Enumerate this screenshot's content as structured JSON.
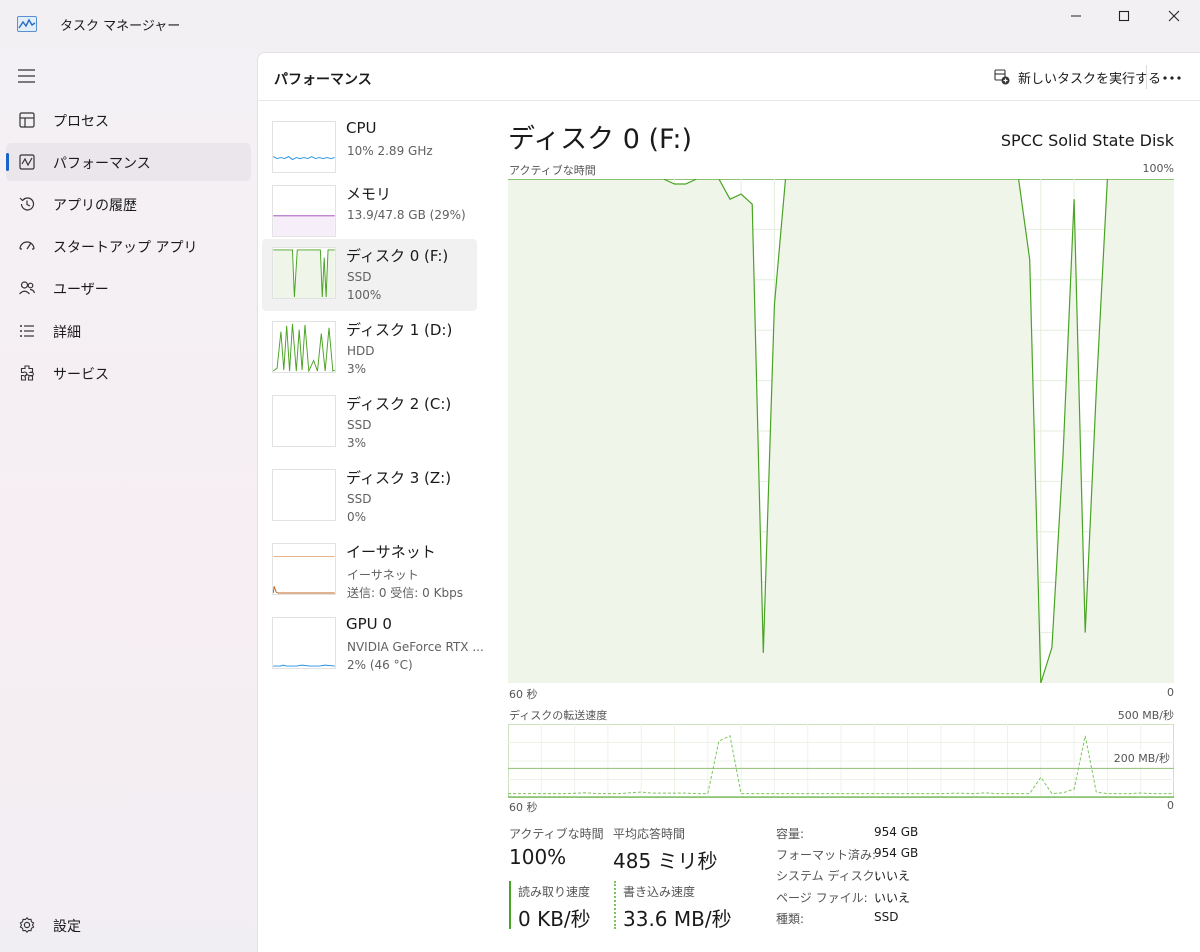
{
  "window": {
    "title": "タスク マネージャー"
  },
  "sidebar": {
    "items": [
      {
        "label": "プロセス",
        "icon": "process-icon"
      },
      {
        "label": "パフォーマンス",
        "icon": "performance-icon",
        "selected": true
      },
      {
        "label": "アプリの履歴",
        "icon": "history-icon"
      },
      {
        "label": "スタートアップ アプリ",
        "icon": "startup-icon"
      },
      {
        "label": "ユーザー",
        "icon": "users-icon"
      },
      {
        "label": "詳細",
        "icon": "details-icon"
      },
      {
        "label": "サービス",
        "icon": "services-icon"
      }
    ],
    "settings_label": "設定"
  },
  "header": {
    "title": "パフォーマンス",
    "run_task_label": "新しいタスクを実行する"
  },
  "devices": [
    {
      "name": "CPU",
      "sub1": "10%  2.89 GHz",
      "sub2": "",
      "color": "#1d8fe0"
    },
    {
      "name": "メモリ",
      "sub1": "13.9/47.8 GB (29%)",
      "sub2": "",
      "color": "#9b3db2"
    },
    {
      "name": "ディスク 0 (F:)",
      "sub1": "SSD",
      "sub2": "100%",
      "color": "#4aa324",
      "selected": true
    },
    {
      "name": "ディスク 1 (D:)",
      "sub1": "HDD",
      "sub2": "3%",
      "color": "#4aa324"
    },
    {
      "name": "ディスク 2 (C:)",
      "sub1": "SSD",
      "sub2": "3%",
      "color": "#4aa324"
    },
    {
      "name": "ディスク 3 (Z:)",
      "sub1": "SSD",
      "sub2": "0%",
      "color": "#4aa324"
    },
    {
      "name": "イーサネット",
      "sub1": "イーサネット",
      "sub2": "送信: 0  受信: 0 Kbps",
      "color": "#c0631d"
    },
    {
      "name": "GPU 0",
      "sub1": "NVIDIA GeForce RTX ...",
      "sub2": "2%  (46 °C)",
      "color": "#1d8fe0"
    }
  ],
  "detail": {
    "title": "ディスク 0 (F:)",
    "model": "SPCC Solid State Disk",
    "active_time_chart": {
      "label": "アクティブな時間",
      "max_label": "100%",
      "x_left_label": "60 秒",
      "x_right_label": "0"
    },
    "transfer_chart": {
      "label": "ディスクの転送速度",
      "max_label": "500 MB/秒",
      "mid_label": "200 MB/秒",
      "x_left_label": "60 秒",
      "x_right_label": "0"
    },
    "stats": {
      "active_time_label": "アクティブな時間",
      "active_time_value": "100%",
      "avg_response_label": "平均応答時間",
      "avg_response_value": "485 ミリ秒",
      "read_label": "読み取り速度",
      "read_value": "0 KB/秒",
      "write_label": "書き込み速度",
      "write_value": "33.6 MB/秒"
    },
    "info": [
      {
        "key": "容量:",
        "value": "954 GB"
      },
      {
        "key": "フォーマット済み:",
        "value": "954 GB"
      },
      {
        "key": "システム ディスク:",
        "value": "いいえ"
      },
      {
        "key": "ページ ファイル:",
        "value": "いいえ"
      },
      {
        "key": "種類:",
        "value": "SSD"
      }
    ]
  },
  "colors": {
    "disk_line": "#4aa324",
    "disk_fill": "#eff6e9",
    "grid": "#e4eedd",
    "accent": "#1a63c8"
  },
  "chart_data": [
    {
      "type": "area",
      "title": "アクティブな時間",
      "xlabel": "",
      "ylabel": "",
      "x_range": [
        60,
        0
      ],
      "ylim": [
        0,
        100
      ],
      "x": [
        60,
        59,
        58,
        57,
        56,
        55,
        54,
        53,
        52,
        51,
        50,
        49,
        48,
        47,
        46,
        45,
        44,
        43,
        42,
        41,
        40,
        39,
        38,
        37,
        36,
        35,
        34,
        33,
        32,
        31,
        30,
        29,
        28,
        27,
        26,
        25,
        24,
        23,
        22,
        21,
        20,
        19,
        18,
        17,
        16,
        15,
        14,
        13,
        12,
        11,
        10,
        9,
        8,
        7,
        6,
        5,
        4,
        3,
        2,
        1,
        0
      ],
      "series": [
        {
          "values": [
            100,
            100,
            100,
            100,
            100,
            100,
            100,
            100,
            100,
            100,
            100,
            100,
            100,
            100,
            100,
            99,
            99,
            100,
            100,
            100,
            96,
            97,
            95,
            6,
            75,
            100,
            100,
            100,
            100,
            100,
            100,
            100,
            100,
            100,
            100,
            100,
            100,
            100,
            100,
            100,
            100,
            100,
            100,
            100,
            100,
            100,
            100,
            84,
            0,
            7,
            45,
            96,
            10,
            58,
            100,
            100,
            100,
            100,
            100,
            100,
            100
          ]
        }
      ]
    },
    {
      "type": "line",
      "title": "ディスクの転送速度",
      "xlabel": "",
      "ylabel": "",
      "x_range": [
        60,
        0
      ],
      "ylim": [
        0,
        500
      ],
      "x": [
        60,
        59,
        58,
        57,
        56,
        55,
        54,
        53,
        52,
        51,
        50,
        49,
        48,
        47,
        46,
        45,
        44,
        43,
        42,
        41,
        40,
        39,
        38,
        37,
        36,
        35,
        34,
        33,
        32,
        31,
        30,
        29,
        28,
        27,
        26,
        25,
        24,
        23,
        22,
        21,
        20,
        19,
        18,
        17,
        16,
        15,
        14,
        13,
        12,
        11,
        10,
        9,
        8,
        7,
        6,
        5,
        4,
        3,
        2,
        1,
        0
      ],
      "series": [
        {
          "name": "読み取り速度",
          "values": [
            0,
            0,
            0,
            0,
            0,
            0,
            0,
            0,
            0,
            0,
            0,
            0,
            0,
            0,
            0,
            0,
            0,
            0,
            0,
            0,
            0,
            0,
            0,
            0,
            0,
            0,
            0,
            0,
            0,
            0,
            0,
            0,
            0,
            0,
            0,
            0,
            0,
            0,
            0,
            0,
            0,
            0,
            0,
            0,
            0,
            0,
            0,
            0,
            0,
            0,
            0,
            0,
            0,
            0,
            0,
            0,
            0,
            0,
            0,
            0,
            0
          ]
        },
        {
          "name": "書き込み速度",
          "values": [
            30,
            30,
            30,
            30,
            30,
            30,
            32,
            35,
            30,
            30,
            30,
            35,
            40,
            33,
            33,
            33,
            33,
            30,
            30,
            385,
            420,
            30,
            30,
            30,
            30,
            30,
            30,
            30,
            30,
            30,
            30,
            30,
            30,
            30,
            30,
            30,
            30,
            30,
            30,
            30,
            32,
            32,
            30,
            35,
            30,
            30,
            30,
            30,
            140,
            30,
            35,
            60,
            420,
            40,
            30,
            30,
            30,
            34,
            30,
            30,
            30
          ]
        }
      ]
    }
  ]
}
